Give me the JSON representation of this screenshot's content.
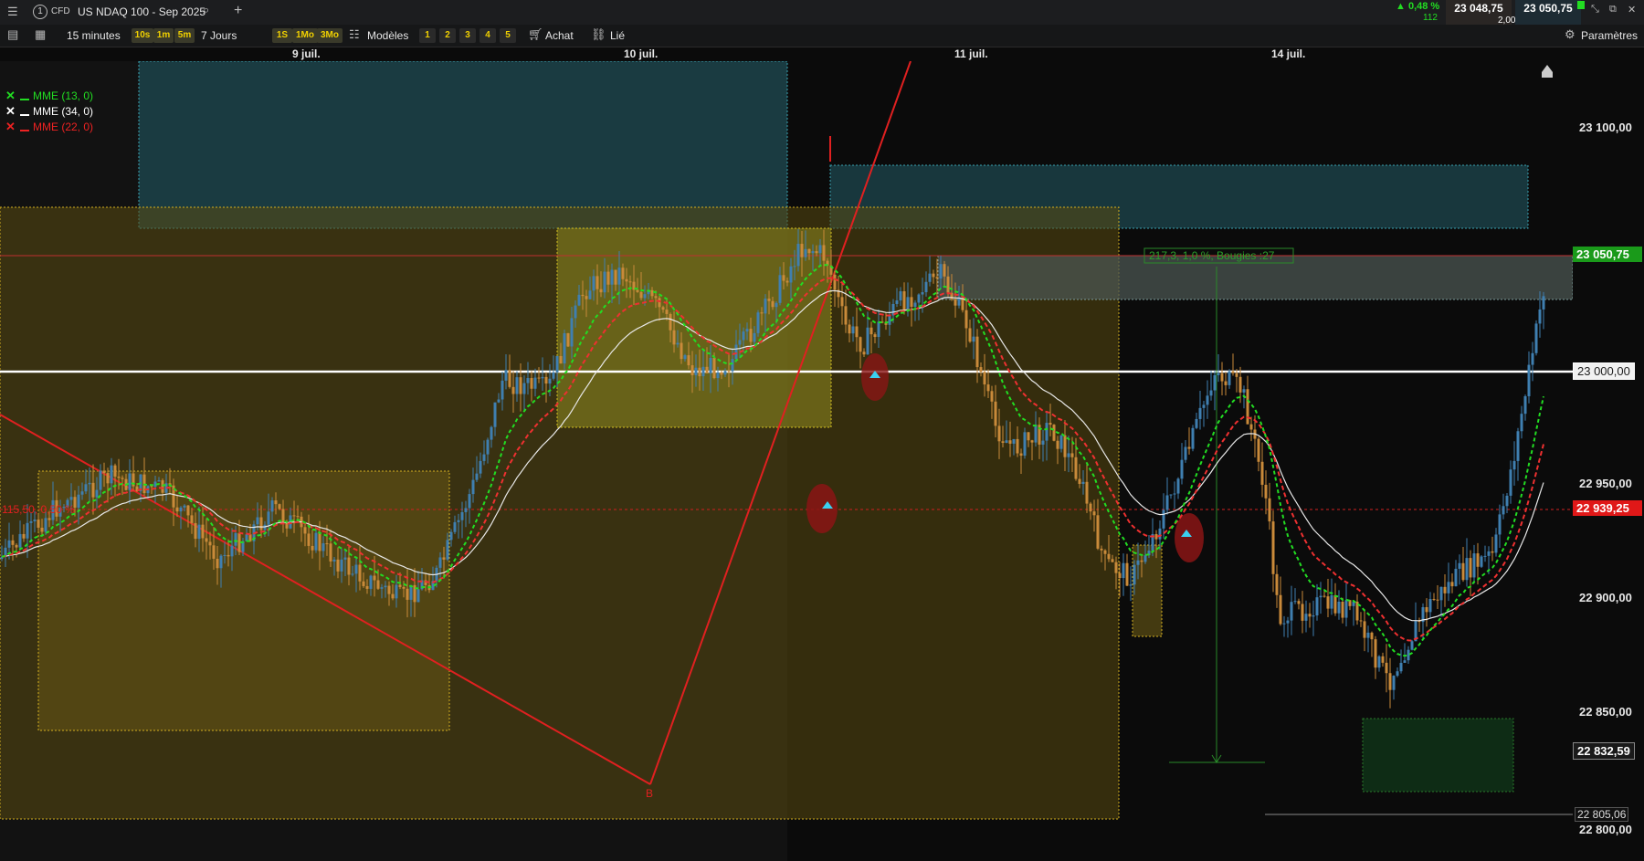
{
  "topbar": {
    "instrument_index": "1",
    "badge": "CFD",
    "title": "US NDAQ 100 - Sep 2025",
    "change_pct": "0,48 %",
    "change_pts": "112",
    "bid": "23 048,75",
    "spread": "2,00",
    "ask": "23 050,75"
  },
  "toolbar": {
    "interval": "15 minutes",
    "quick_intervals": [
      "10s",
      "1m",
      "5m"
    ],
    "range": "7 Jours",
    "quick_ranges": [
      "1S",
      "1Mo",
      "3Mo"
    ],
    "models": "Modèles",
    "numbers": [
      "1",
      "2",
      "3",
      "4",
      "5"
    ],
    "buy": "Achat",
    "linked": "Lié",
    "settings": "Paramètres"
  },
  "dates": [
    "9 juil.",
    "10 juil.",
    "11 juil.",
    "14 juil."
  ],
  "legend": [
    {
      "label": "MME (13, 0)",
      "color": "#22dd22"
    },
    {
      "label": "MME (34, 0)",
      "color": "#ffffff"
    },
    {
      "label": "MME (22, 0)",
      "color": "#ee2222"
    }
  ],
  "annotations": {
    "measure": "217,3, 1,0 %, Bougies :27",
    "left_level": "115,50, 0,50 %",
    "point_b": "B"
  },
  "price_axis": {
    "ticks": [
      "23 100,00",
      "23 050,75",
      "23 000,00",
      "22 950,00",
      "22 939,25",
      "22 900,00",
      "22 850,00",
      "22 832,59",
      "22 805,06",
      "22 800,00"
    ],
    "current_price": "23 050,75",
    "red_level": "22 939,25",
    "white_level": "23 000,00",
    "low_level": "22 832,59",
    "min_level": "22 805,06"
  },
  "chart_data": {
    "type": "candlestick",
    "instrument": "US NDAQ 100 - Sep 2025",
    "interval": "15 minutes",
    "x": [
      "9 juil.",
      "10 juil.",
      "11 juil.",
      "14 juil."
    ],
    "ylim": [
      22790,
      23125
    ],
    "series": [
      {
        "name": "MME (13, 0)",
        "color": "#22dd22",
        "style": "dashed"
      },
      {
        "name": "MME (34, 0)",
        "color": "#ffffff",
        "style": "solid"
      },
      {
        "name": "MME (22, 0)",
        "color": "#ee2222",
        "style": "dashed"
      }
    ],
    "grid": false
  }
}
